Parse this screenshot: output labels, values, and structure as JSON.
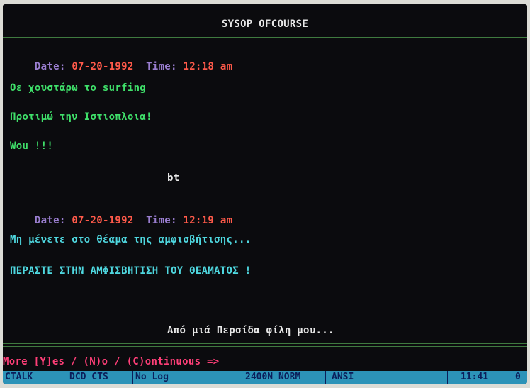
{
  "header": {
    "title": "SYSOP OFCOURSE"
  },
  "messages": [
    {
      "date_label": "Date:",
      "date": "07-20-1992",
      "time_label": "Time:",
      "time": "12:18 am",
      "lines": [
        "Οε χουστάρω το surfing",
        "Προτιμώ την Ιστιοπλοια!",
        "Wou !!!"
      ],
      "signature": "bt"
    },
    {
      "date_label": "Date:",
      "date": "07-20-1992",
      "time_label": "Time:",
      "time": "12:19 am",
      "lines": [
        "Μη μένετε στο θέαμα της αμφισβήτισης...",
        "ΠΕΡΑΣΤΕ ΣΤΗΝ ΑΜΦΙΣΒΗΤΙΣΗ ΤΟΥ ΘΕΑΜΑΤΟΣ !"
      ],
      "signature": "Από μιά Περσίδα φίλη μου..."
    }
  ],
  "prompt": {
    "text": "More [Y]es / (N)o / (C)ontinuous =>"
  },
  "status_bar": {
    "mode": "CTALK",
    "signals": "DCD CTS",
    "log": "No Log",
    "speed": "2400N NORM",
    "emulation": "ANSI",
    "clock": "11:41",
    "counter": "0"
  },
  "colors": {
    "background": "#0b0b0e",
    "label": "#9a7ed0",
    "value": "#ff5a4a",
    "message_text": "#3fe06a",
    "highlight_text": "#4fd8e0",
    "prompt": "#ff3f78",
    "status_bar": "#2c93b8"
  }
}
